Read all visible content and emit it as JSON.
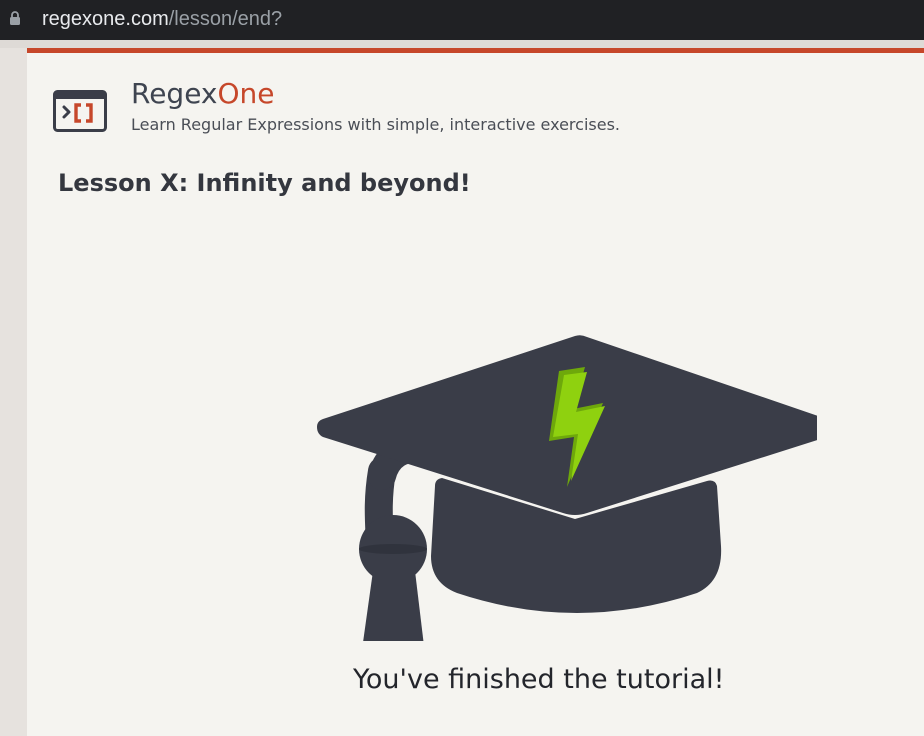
{
  "browser": {
    "url_host": "regexone.com",
    "url_path": "/lesson/end?"
  },
  "header": {
    "brand_prefix": "Regex",
    "brand_suffix": "One",
    "tagline": "Learn Regular Expressions with simple, interactive exercises."
  },
  "lesson": {
    "title": "Lesson X: Infinity and beyond!",
    "message": "You've finished the tutorial!"
  },
  "icons": {
    "address_bar": "lock-icon",
    "logo": "regexone-logo-icon",
    "illustration": "graduation-cap-icon",
    "emblem": "lightning-bolt-icon"
  },
  "colors": {
    "accent": "#c6472a",
    "cap": "#3a3d48",
    "bolt": "#8fd10f",
    "page_background": "#f5f4f0"
  }
}
